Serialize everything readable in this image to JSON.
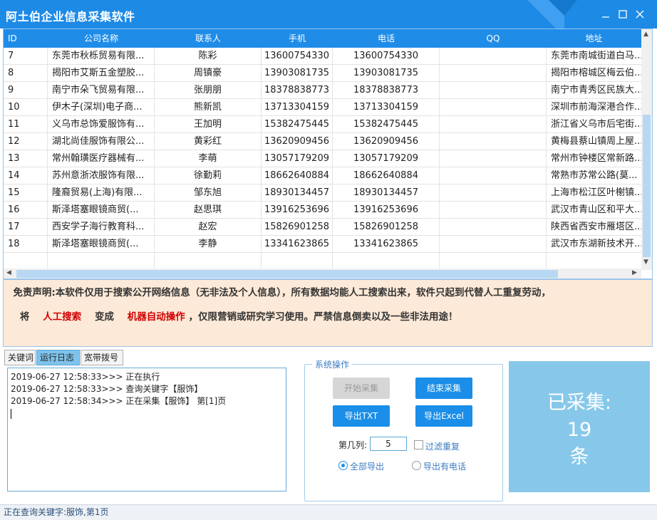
{
  "window": {
    "title": "阿土伯企业信息采集软件"
  },
  "grid": {
    "columns": [
      "ID",
      "公司名称",
      "联系人",
      "手机",
      "电话",
      "QQ",
      "地址"
    ],
    "rows": [
      {
        "id": "7",
        "name": "东莞市秋栎贸易有限...",
        "contact": "陈彩",
        "mobile": "13600754330",
        "phone": "13600754330",
        "qq": "",
        "addr": "东莞市南城街道白马..."
      },
      {
        "id": "8",
        "name": "揭阳市艾斯五金塑胶...",
        "contact": "周镇豪",
        "mobile": "13903081735",
        "phone": "13903081735",
        "qq": "",
        "addr": "揭阳市榕城区梅云伯..."
      },
      {
        "id": "9",
        "name": "南宁市朵飞贸易有限...",
        "contact": "张朋朋",
        "mobile": "18378838773",
        "phone": "18378838773",
        "qq": "",
        "addr": "南宁市青秀区民族大..."
      },
      {
        "id": "10",
        "name": "伊木子(深圳)电子商...",
        "contact": "熊新凯",
        "mobile": "13713304159",
        "phone": "13713304159",
        "qq": "",
        "addr": "深圳市前海深港合作..."
      },
      {
        "id": "11",
        "name": "义乌市总饰爱服饰有...",
        "contact": "王加明",
        "mobile": "15382475445",
        "phone": "15382475445",
        "qq": "",
        "addr": "浙江省义乌市后宅街..."
      },
      {
        "id": "12",
        "name": "湖北尚佳服饰有限公...",
        "contact": "黄彩红",
        "mobile": "13620909456",
        "phone": "13620909456",
        "qq": "",
        "addr": "黄梅县蔡山镇周上屋..."
      },
      {
        "id": "13",
        "name": "常州翰璜医疗器械有...",
        "contact": "李萌",
        "mobile": "13057179209",
        "phone": "13057179209",
        "qq": "",
        "addr": "常州市钟楼区常新路..."
      },
      {
        "id": "14",
        "name": "苏州意浙浓服饰有限...",
        "contact": "徐勤莉",
        "mobile": "18662640884",
        "phone": "18662640884",
        "qq": "",
        "addr": "常熟市苏常公路(莫..."
      },
      {
        "id": "15",
        "name": "隆裔贸易(上海)有限...",
        "contact": "邹东旭",
        "mobile": "18930134457",
        "phone": "18930134457",
        "qq": "",
        "addr": "上海市松江区叶榭镇..."
      },
      {
        "id": "16",
        "name": "斯泽塔塞眼镜商贸(...",
        "contact": "赵思琪",
        "mobile": "13916253696",
        "phone": "13916253696",
        "qq": "",
        "addr": "武汉市青山区和平大..."
      },
      {
        "id": "17",
        "name": "西安学子海行教育科...",
        "contact": "赵宏",
        "mobile": "15826901258",
        "phone": "15826901258",
        "qq": "",
        "addr": "陕西省西安市雁塔区..."
      },
      {
        "id": "18",
        "name": "斯泽塔塞眼镜商贸(...",
        "contact": "李静",
        "mobile": "13341623865",
        "phone": "13341623865",
        "qq": "",
        "addr": "武汉市东湖新技术开..."
      }
    ]
  },
  "disclaimer": {
    "line1": "  免责声明:本软件仅用于搜索公开网络信息（无非法及个人信息），所有数据均能人工搜索出来，软件只起到代替人工重复劳动，",
    "line2_prefix": "将",
    "term1": "人工搜索",
    "mid": "变成",
    "term2": "机器自动操作",
    "line2_suffix": "，仅限营销或研究学习使用。严禁信息倒卖以及一些非法用途！"
  },
  "tabs": [
    {
      "label": "关键词",
      "active": false
    },
    {
      "label": "运行日志",
      "active": true
    },
    {
      "label": "宽带拨号",
      "active": false
    }
  ],
  "log": [
    "2019-06-27 12:58:33>>> 正在执行",
    "2019-06-27 12:58:33>>> 查询关键字【服饰】",
    "2019-06-27 12:58:34>>> 正在采集【服饰】 第[1]页"
  ],
  "sysops": {
    "legend": "系统操作",
    "start_label": "开始采集",
    "stop_label": "结束采集",
    "export_txt_label": "导出TXT",
    "export_excel_label": "导出Excel",
    "column_label": "第几列:",
    "column_value": "5",
    "filter_dup_label": "过滤重复",
    "filter_dup_checked": false,
    "export_all_label": "全部导出",
    "export_all_selected": true,
    "export_phone_label": "导出有电话",
    "export_phone_selected": false
  },
  "counter": {
    "label": "已采集:",
    "value": "19",
    "unit": "条"
  },
  "status": {
    "text": "正在查询关键字:服饰,第1页"
  },
  "colors": {
    "titlebar": "#1d8ae6",
    "header": "#1f8ce8",
    "button": "#1a8ee8",
    "disclaimer_bg": "#fce9d7",
    "counter_bg": "#87c8ea",
    "highlight_red": "#d00000"
  }
}
